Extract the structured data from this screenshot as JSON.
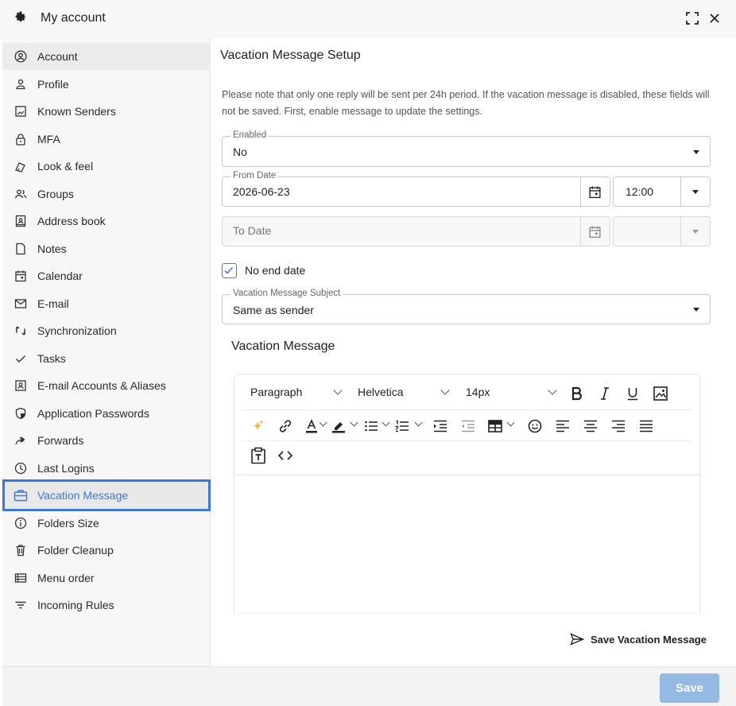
{
  "window": {
    "title": "My account"
  },
  "sidebar": {
    "items": [
      {
        "label": "Account",
        "icon": "account-circle-icon"
      },
      {
        "label": "Profile",
        "icon": "person-icon"
      },
      {
        "label": "Known Senders",
        "icon": "image-frame-icon"
      },
      {
        "label": "MFA",
        "icon": "lock-icon"
      },
      {
        "label": "Look & feel",
        "icon": "palette-icon"
      },
      {
        "label": "Groups",
        "icon": "group-icon"
      },
      {
        "label": "Address book",
        "icon": "contact-book-icon"
      },
      {
        "label": "Notes",
        "icon": "note-icon"
      },
      {
        "label": "Calendar",
        "icon": "calendar-icon"
      },
      {
        "label": "E-mail",
        "icon": "mail-icon"
      },
      {
        "label": "Synchronization",
        "icon": "sync-icon"
      },
      {
        "label": "Tasks",
        "icon": "check-icon"
      },
      {
        "label": "E-mail Accounts & Aliases",
        "icon": "contact-card-icon"
      },
      {
        "label": "Application Passwords",
        "icon": "shield-icon"
      },
      {
        "label": "Forwards",
        "icon": "forward-icon"
      },
      {
        "label": "Last Logins",
        "icon": "clock-icon"
      },
      {
        "label": "Vacation Message",
        "icon": "briefcase-icon"
      },
      {
        "label": "Folders Size",
        "icon": "info-icon"
      },
      {
        "label": "Folder Cleanup",
        "icon": "trash-icon"
      },
      {
        "label": "Menu order",
        "icon": "list-icon"
      },
      {
        "label": "Incoming Rules",
        "icon": "filter-icon"
      }
    ],
    "selected": "Vacation Message"
  },
  "main": {
    "title": "Vacation Message Setup",
    "note": "Please note that only one reply will be sent per 24h period. If the vacation message is disabled, these fields will not be saved. First, enable message to update the settings.",
    "enabled": {
      "label": "Enabled",
      "value": "No"
    },
    "from_date": {
      "label": "From Date",
      "value": "2026-06-23",
      "time": "12:00"
    },
    "to_date": {
      "placeholder": "To Date",
      "time": ""
    },
    "no_end_date": {
      "label": "No end date",
      "checked": true
    },
    "subject": {
      "label": "Vacation Message Subject",
      "value": "Same as sender"
    },
    "message_title": "Vacation Message",
    "editor": {
      "block_format": "Paragraph",
      "font_family": "Helvetica",
      "font_size": "14px",
      "body": ""
    },
    "save_link": "Save Vacation Message"
  },
  "footer": {
    "save_label": "Save"
  },
  "colors": {
    "accent": "#3b78d8",
    "save_button": "#94b9e3"
  }
}
